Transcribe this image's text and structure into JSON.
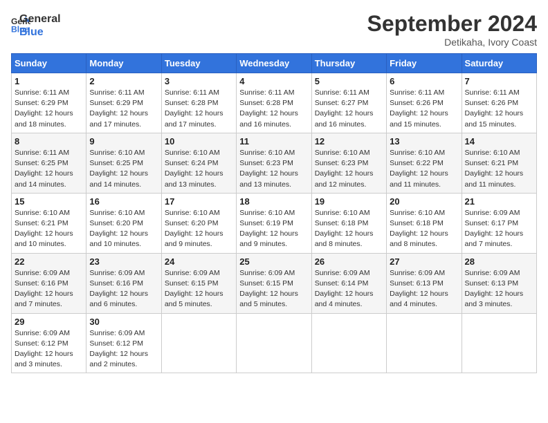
{
  "logo": {
    "line1": "General",
    "line2": "Blue"
  },
  "title": "September 2024",
  "location": "Detikaha, Ivory Coast",
  "days_of_week": [
    "Sunday",
    "Monday",
    "Tuesday",
    "Wednesday",
    "Thursday",
    "Friday",
    "Saturday"
  ],
  "weeks": [
    [
      {
        "day": 1,
        "sunrise": "6:11 AM",
        "sunset": "6:29 PM",
        "daylight": "12 hours and 18 minutes."
      },
      {
        "day": 2,
        "sunrise": "6:11 AM",
        "sunset": "6:29 PM",
        "daylight": "12 hours and 17 minutes."
      },
      {
        "day": 3,
        "sunrise": "6:11 AM",
        "sunset": "6:28 PM",
        "daylight": "12 hours and 17 minutes."
      },
      {
        "day": 4,
        "sunrise": "6:11 AM",
        "sunset": "6:28 PM",
        "daylight": "12 hours and 16 minutes."
      },
      {
        "day": 5,
        "sunrise": "6:11 AM",
        "sunset": "6:27 PM",
        "daylight": "12 hours and 16 minutes."
      },
      {
        "day": 6,
        "sunrise": "6:11 AM",
        "sunset": "6:26 PM",
        "daylight": "12 hours and 15 minutes."
      },
      {
        "day": 7,
        "sunrise": "6:11 AM",
        "sunset": "6:26 PM",
        "daylight": "12 hours and 15 minutes."
      }
    ],
    [
      {
        "day": 8,
        "sunrise": "6:11 AM",
        "sunset": "6:25 PM",
        "daylight": "12 hours and 14 minutes."
      },
      {
        "day": 9,
        "sunrise": "6:10 AM",
        "sunset": "6:25 PM",
        "daylight": "12 hours and 14 minutes."
      },
      {
        "day": 10,
        "sunrise": "6:10 AM",
        "sunset": "6:24 PM",
        "daylight": "12 hours and 13 minutes."
      },
      {
        "day": 11,
        "sunrise": "6:10 AM",
        "sunset": "6:23 PM",
        "daylight": "12 hours and 13 minutes."
      },
      {
        "day": 12,
        "sunrise": "6:10 AM",
        "sunset": "6:23 PM",
        "daylight": "12 hours and 12 minutes."
      },
      {
        "day": 13,
        "sunrise": "6:10 AM",
        "sunset": "6:22 PM",
        "daylight": "12 hours and 11 minutes."
      },
      {
        "day": 14,
        "sunrise": "6:10 AM",
        "sunset": "6:21 PM",
        "daylight": "12 hours and 11 minutes."
      }
    ],
    [
      {
        "day": 15,
        "sunrise": "6:10 AM",
        "sunset": "6:21 PM",
        "daylight": "12 hours and 10 minutes."
      },
      {
        "day": 16,
        "sunrise": "6:10 AM",
        "sunset": "6:20 PM",
        "daylight": "12 hours and 10 minutes."
      },
      {
        "day": 17,
        "sunrise": "6:10 AM",
        "sunset": "6:20 PM",
        "daylight": "12 hours and 9 minutes."
      },
      {
        "day": 18,
        "sunrise": "6:10 AM",
        "sunset": "6:19 PM",
        "daylight": "12 hours and 9 minutes."
      },
      {
        "day": 19,
        "sunrise": "6:10 AM",
        "sunset": "6:18 PM",
        "daylight": "12 hours and 8 minutes."
      },
      {
        "day": 20,
        "sunrise": "6:10 AM",
        "sunset": "6:18 PM",
        "daylight": "12 hours and 8 minutes."
      },
      {
        "day": 21,
        "sunrise": "6:09 AM",
        "sunset": "6:17 PM",
        "daylight": "12 hours and 7 minutes."
      }
    ],
    [
      {
        "day": 22,
        "sunrise": "6:09 AM",
        "sunset": "6:16 PM",
        "daylight": "12 hours and 7 minutes."
      },
      {
        "day": 23,
        "sunrise": "6:09 AM",
        "sunset": "6:16 PM",
        "daylight": "12 hours and 6 minutes."
      },
      {
        "day": 24,
        "sunrise": "6:09 AM",
        "sunset": "6:15 PM",
        "daylight": "12 hours and 5 minutes."
      },
      {
        "day": 25,
        "sunrise": "6:09 AM",
        "sunset": "6:15 PM",
        "daylight": "12 hours and 5 minutes."
      },
      {
        "day": 26,
        "sunrise": "6:09 AM",
        "sunset": "6:14 PM",
        "daylight": "12 hours and 4 minutes."
      },
      {
        "day": 27,
        "sunrise": "6:09 AM",
        "sunset": "6:13 PM",
        "daylight": "12 hours and 4 minutes."
      },
      {
        "day": 28,
        "sunrise": "6:09 AM",
        "sunset": "6:13 PM",
        "daylight": "12 hours and 3 minutes."
      }
    ],
    [
      {
        "day": 29,
        "sunrise": "6:09 AM",
        "sunset": "6:12 PM",
        "daylight": "12 hours and 3 minutes."
      },
      {
        "day": 30,
        "sunrise": "6:09 AM",
        "sunset": "6:12 PM",
        "daylight": "12 hours and 2 minutes."
      },
      null,
      null,
      null,
      null,
      null
    ]
  ]
}
